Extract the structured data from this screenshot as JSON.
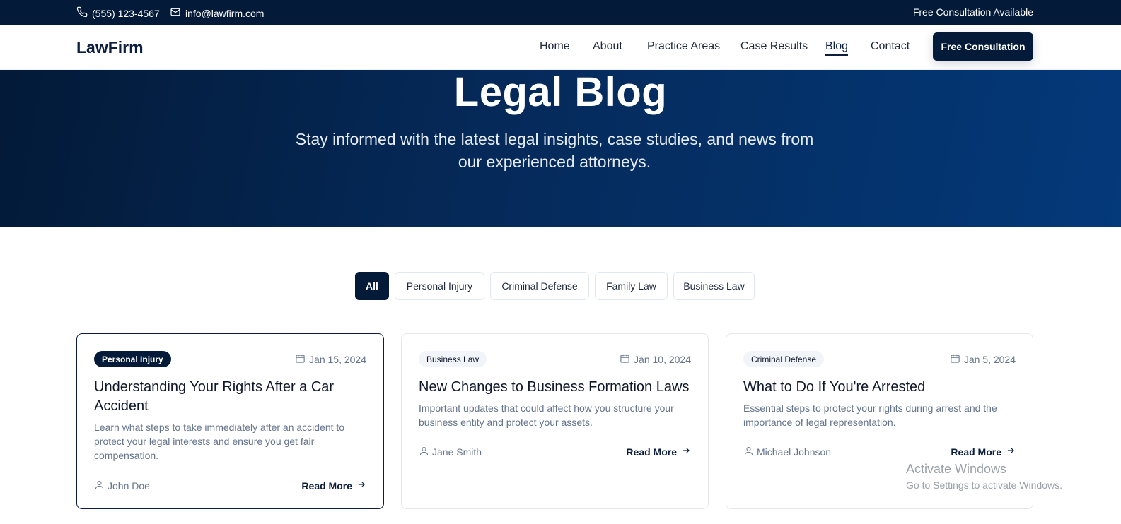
{
  "topbar": {
    "phone": "(555) 123-4567",
    "email": "info@lawfirm.com",
    "consultation_note": "Free Consultation Available"
  },
  "nav": {
    "logo": "LawFirm",
    "links": [
      "Home",
      "About",
      "Practice Areas",
      "Case Results",
      "Blog",
      "Contact"
    ],
    "active": "Blog",
    "cta": "Free Consultation"
  },
  "hero": {
    "title": "Legal Blog",
    "subtitle": "Stay informed with the latest legal insights, case studies, and news from our experienced attorneys."
  },
  "filters": [
    "All",
    "Personal Injury",
    "Criminal Defense",
    "Family Law",
    "Business Law"
  ],
  "active_filter": "All",
  "posts": [
    {
      "category": "Personal Injury",
      "date": "Jan 15, 2024",
      "title": "Understanding Your Rights After a Car Accident",
      "excerpt": "Learn what steps to take immediately after an accident to protect your legal interests and ensure you get fair compensation.",
      "author": "John Doe",
      "read_more": "Read More"
    },
    {
      "category": "Business Law",
      "date": "Jan 10, 2024",
      "title": "New Changes to Business Formation Laws",
      "excerpt": "Important updates that could affect how you structure your business entity and protect your assets.",
      "author": "Jane Smith",
      "read_more": "Read More"
    },
    {
      "category": "Criminal Defense",
      "date": "Jan 5, 2024",
      "title": "What to Do If You're Arrested",
      "excerpt": "Essential steps to protect your rights during arrest and the importance of legal representation.",
      "author": "Michael Johnson",
      "read_more": "Read More"
    }
  ],
  "watermark": {
    "line1": "Activate Windows",
    "line2": "Go to Settings to activate Windows."
  },
  "colors": {
    "navy": "#031a38",
    "hero_end": "#04397a",
    "muted": "#64748b"
  }
}
